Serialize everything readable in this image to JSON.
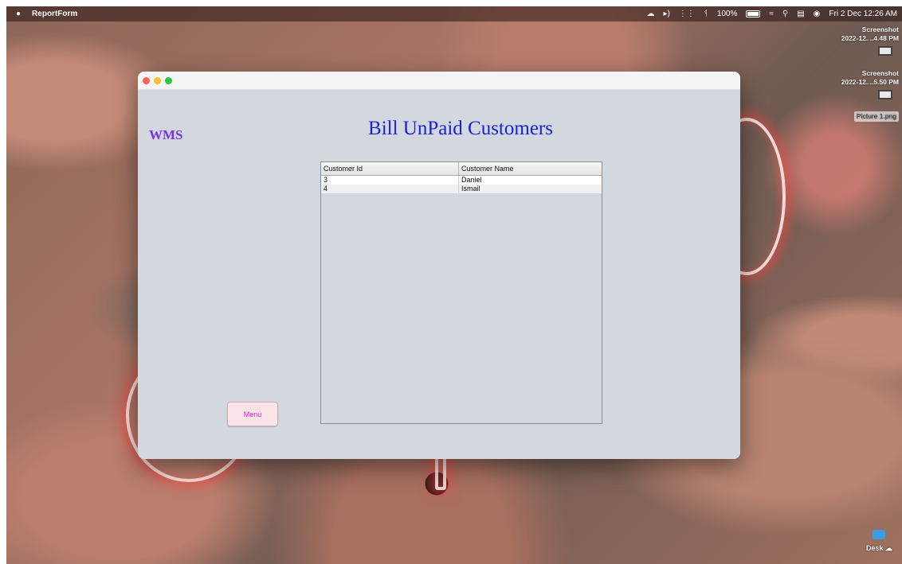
{
  "menubar": {
    "apple_icon": "apple-logo-icon",
    "app_name": "ReportForm",
    "battery_percent": "100%",
    "datetime": "Fri 2 Dec  12:26 AM"
  },
  "desktop": {
    "items": [
      {
        "line1": "Screenshot",
        "line2": "2022-12....4.48 PM",
        "icon": "screenshot-file-icon"
      },
      {
        "line1": "Screenshot",
        "line2": "2022-12....5.50 PM",
        "icon": "screenshot-file-icon"
      },
      {
        "label": "Picture 1.png",
        "icon": "image-file-icon"
      }
    ],
    "folder": {
      "label": "Desk",
      "icon": "folder-icon"
    }
  },
  "window": {
    "brand": "WMS",
    "title": "Bill UnPaid Customers",
    "table": {
      "headers": [
        "Customer Id",
        "Customer Name"
      ],
      "rows": [
        [
          "3",
          "Daniel"
        ],
        [
          "4",
          "Ismail"
        ]
      ]
    },
    "menu_button": "Menu"
  },
  "colors": {
    "title_blue": "#1b22d6",
    "brand_purple": "#7a33e0",
    "menu_text": "#e21fd7",
    "window_bg": "#d3d7de"
  }
}
